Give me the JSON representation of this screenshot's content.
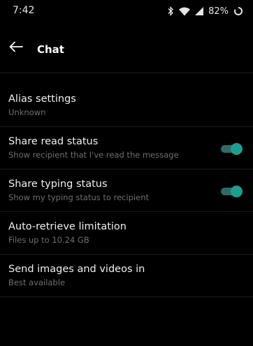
{
  "status_bar": {
    "time": "7:42",
    "battery_percent": "82%",
    "icons": [
      "bluetooth-icon",
      "wifi-icon",
      "signal-icon",
      "battery-icon"
    ]
  },
  "header": {
    "title": "Chat",
    "back_icon": "arrow-left-icon"
  },
  "settings": [
    {
      "title": "Alias settings",
      "subtitle": "Unknown"
    },
    {
      "title": "Share read status",
      "subtitle": "Show recipient that I've read the message",
      "toggle": true
    },
    {
      "title": "Share typing status",
      "subtitle": "Show my typing status to recipient",
      "toggle": true
    },
    {
      "title": "Auto-retrieve limitation",
      "subtitle": "Files up to 10.24 GB"
    },
    {
      "title": "Send images and videos in",
      "subtitle": "Best available"
    }
  ],
  "colors": {
    "background": "#000000",
    "accent": "#1f9e8f",
    "accent_track": "#2f6b66",
    "primary_text": "#f0f0f0",
    "secondary_text": "#6f6f6f"
  }
}
